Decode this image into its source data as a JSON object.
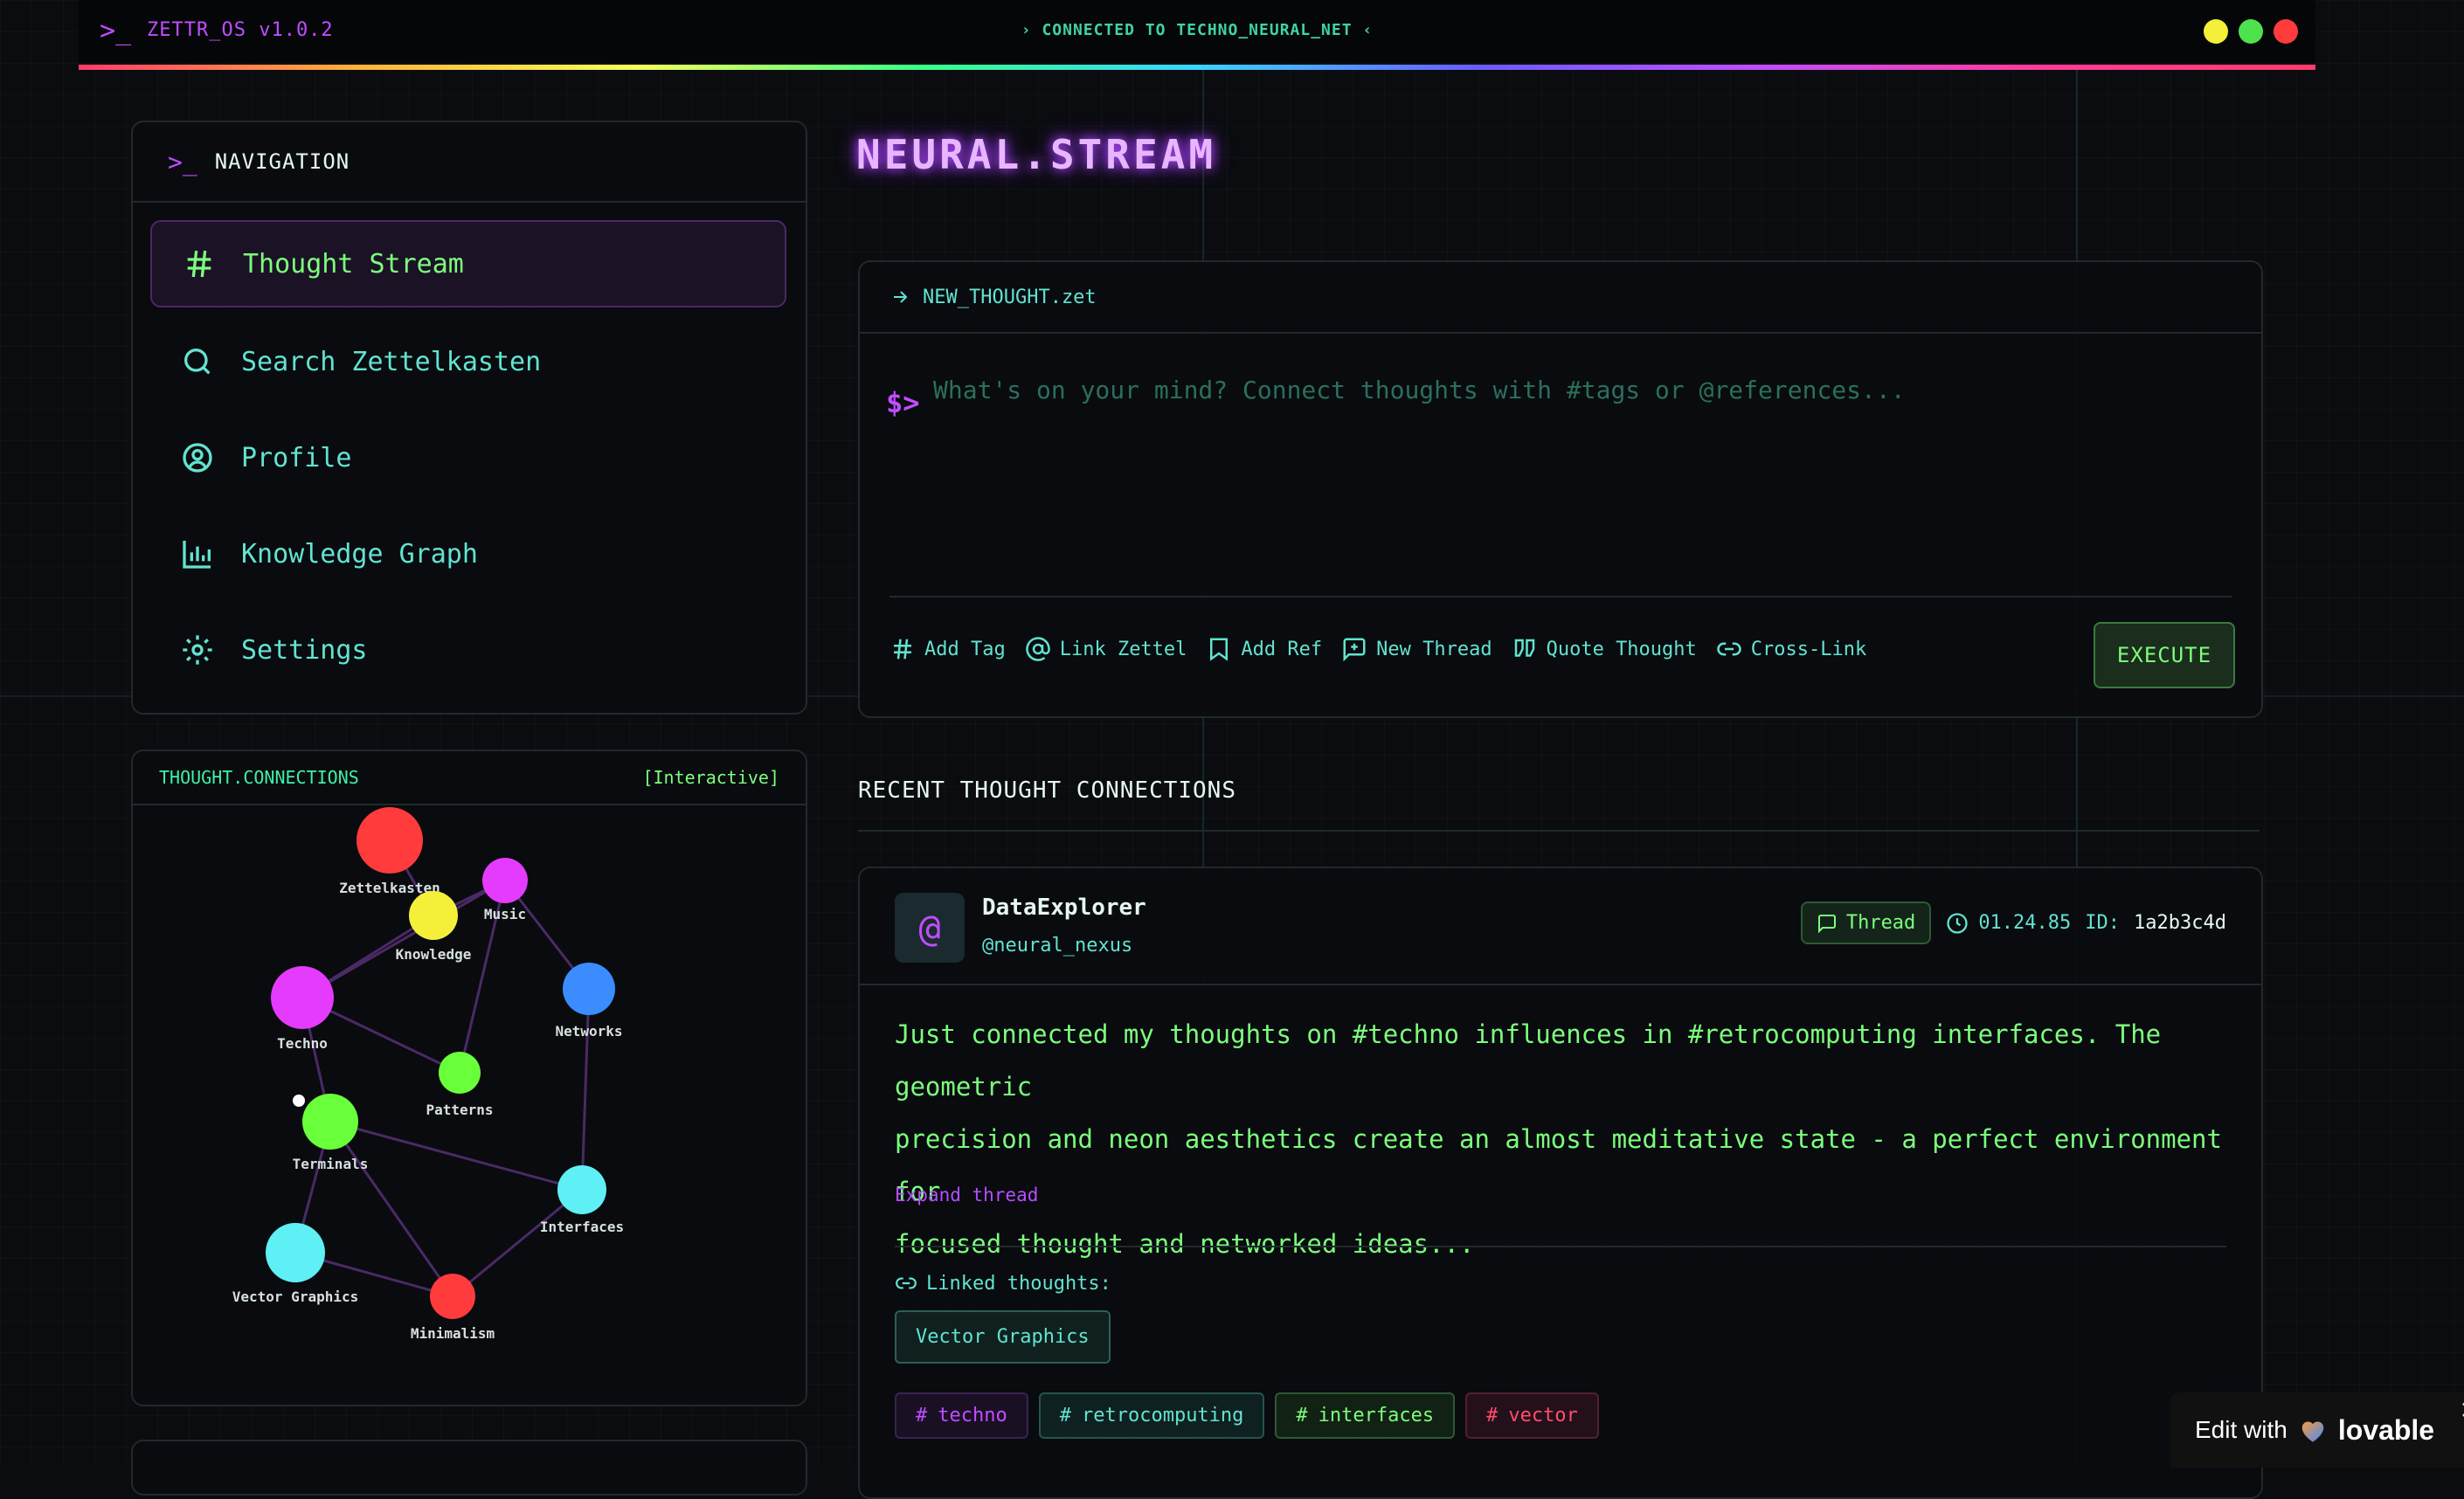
{
  "topbar": {
    "prompt": ">_",
    "title": "ZETTR_OS v1.0.2",
    "connection": "› CONNECTED TO TECHNO_NEURAL_NET ‹",
    "dot_colors": [
      "#f4f03a",
      "#4ee24e",
      "#ff3b3b"
    ]
  },
  "nav": {
    "prompt": ">_",
    "title": "NAVIGATION",
    "items": [
      {
        "label": "Thought Stream",
        "icon": "hash-icon"
      },
      {
        "label": "Search Zettelkasten",
        "icon": "search-icon"
      },
      {
        "label": "Profile",
        "icon": "user-icon"
      },
      {
        "label": "Knowledge Graph",
        "icon": "bar-chart-icon"
      },
      {
        "label": "Settings",
        "icon": "gear-icon"
      }
    ]
  },
  "connections": {
    "title": "THOUGHT.CONNECTIONS",
    "tag": "[Interactive]",
    "nodes": [
      {
        "label": "Zettelkasten",
        "color": "#ff3b3b"
      },
      {
        "label": "Music",
        "color": "#e43bff"
      },
      {
        "label": "Knowledge",
        "color": "#f4f03a"
      },
      {
        "label": "Techno",
        "color": "#e43bff"
      },
      {
        "label": "Networks",
        "color": "#3b8cff"
      },
      {
        "label": "Patterns",
        "color": "#6aff3b"
      },
      {
        "label": "Terminals",
        "color": "#6aff3b"
      },
      {
        "label": "Interfaces",
        "color": "#5ef0f5"
      },
      {
        "label": "Vector Graphics",
        "color": "#5ef0f5"
      },
      {
        "label": "Minimalism",
        "color": "#ff3b3b"
      }
    ]
  },
  "main": {
    "title": "NEURAL.STREAM",
    "composer": {
      "filename": "NEW_THOUGHT.zet",
      "prompt": "$>",
      "placeholder": "What's on your mind? Connect thoughts with #tags or @references...",
      "tools": [
        {
          "label": "Add Tag",
          "icon": "hash-icon"
        },
        {
          "label": "Link Zettel",
          "icon": "at-icon"
        },
        {
          "label": "Add Ref",
          "icon": "bookmark-icon"
        },
        {
          "label": "New Thread",
          "icon": "message-plus-icon"
        },
        {
          "label": "Quote Thought",
          "icon": "quote-icon"
        },
        {
          "label": "Cross-Link",
          "icon": "link-icon"
        }
      ],
      "execute_label": "EXECUTE"
    },
    "recent_title": "RECENT THOUGHT CONNECTIONS",
    "post": {
      "avatar": "@",
      "username": "DataExplorer",
      "handle": "@neural_nexus",
      "badge": "Thread",
      "time": "01.24.85",
      "id_label": "ID:",
      "id_value": "1a2b3c4d",
      "line1": "Just connected my thoughts on #techno influences in #retrocomputing interfaces. The geometric",
      "line2": "precision and neon aesthetics create an almost meditative state - a perfect environment for",
      "line3": "focused thought and networked ideas...",
      "expand": "Expand thread",
      "linked_label": "Linked thoughts:",
      "linked": [
        "Vector Graphics"
      ],
      "tags": [
        "techno",
        "retrocomputing",
        "interfaces",
        "vector"
      ]
    }
  },
  "lovable": {
    "text": "Edit with",
    "brand": "lovable",
    "close": "✕"
  }
}
